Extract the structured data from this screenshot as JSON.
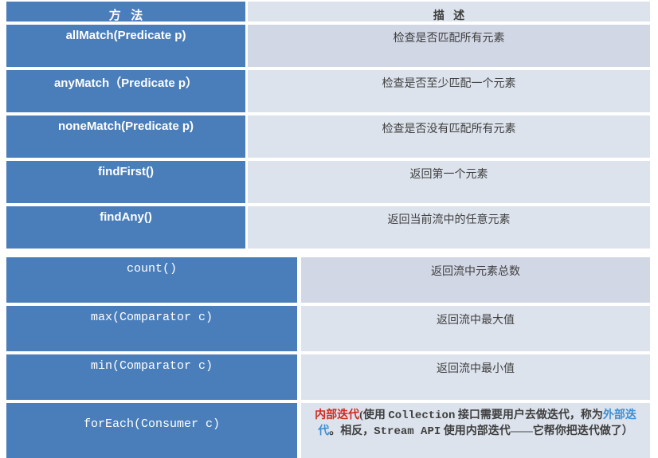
{
  "header": {
    "method_label": "方 法",
    "description_label": "描 述"
  },
  "colors": {
    "header_bg": "#0c2461",
    "method_bg": "#4a7ebb",
    "desc_bg": "#dce3ed",
    "desc_bg_alt": "#d2d7e6",
    "page_bg": "#ffffff",
    "accent_red": "#d42a21",
    "accent_blue": "#3f8fd4"
  },
  "table_upper": {
    "rows": [
      {
        "method": "allMatch(Predicate p)",
        "description": "检查是否匹配所有元素"
      },
      {
        "method": "anyMatch（Predicate p）",
        "description": "检查是否至少匹配一个元素"
      },
      {
        "method": "noneMatch(Predicate  p)",
        "description": "检查是否没有匹配所有元素"
      },
      {
        "method": "findFirst()",
        "description": "返回第一个元素"
      },
      {
        "method": "findAny()",
        "description": "返回当前流中的任意元素"
      }
    ]
  },
  "table_lower": {
    "rows": [
      {
        "method": "count()",
        "description": "返回流中元素总数"
      },
      {
        "method": "max(Comparator c)",
        "description": "返回流中最大值"
      },
      {
        "method": "min(Comparator c)",
        "description": "返回流中最小值"
      },
      {
        "method": "forEach(Consumer c)",
        "description": "内部迭代(使用 Collection 接口需要用户去做迭代，称为外部迭代。相反，Stream API 使用内部迭代——它帮你把迭代做了）"
      }
    ],
    "foreach_description_parts": {
      "red_term": "内部迭代",
      "segment_1": "(使用 ",
      "mono_1": "Collection",
      "segment_2": " 接口需要用户去做迭代，称为",
      "blue_term": "外部迭代",
      "segment_3": "。相反，",
      "mono_2": "Stream API",
      "segment_4": " 使用内部迭代——它帮你把迭代做了）"
    }
  }
}
